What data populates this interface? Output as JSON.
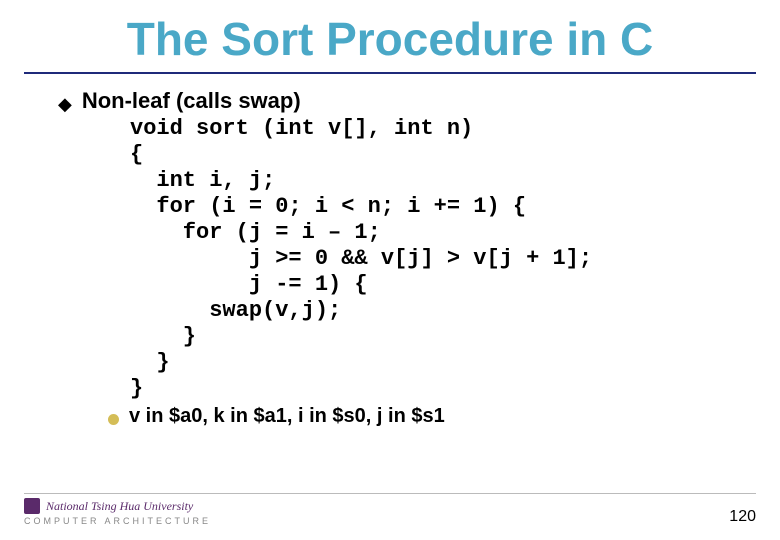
{
  "title": "The Sort Procedure in C",
  "bullet1": "Non-leaf (calls swap)",
  "code_lines": [
    "void sort (int v[], int n)",
    "{",
    "  int i, j;",
    "  for (i = 0; i < n; i += 1) {",
    "    for (j = i – 1;",
    "         j >= 0 && v[j] > v[j + 1];",
    "         j -= 1) {",
    "      swap(v,j);",
    "    }",
    "  }",
    "}"
  ],
  "sub_bullet": "v in $a0, k in $a1, i in $s0, j in $s1",
  "footer": {
    "university": "National Tsing Hua University",
    "course": "COMPUTER ARCHITECTURE",
    "page": "120"
  }
}
